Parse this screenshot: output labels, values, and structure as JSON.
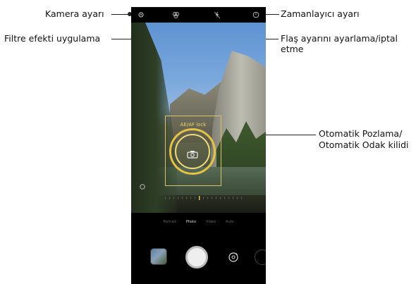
{
  "callouts": {
    "camera_settings": "Kamera ayarı",
    "filter_effect": "Filtre efekti uygulama",
    "timer_settings": "Zamanlayıcı ayarı",
    "flash_line1": "Flaş ayarını ayarlama/iptal",
    "flash_line2": "etme",
    "ae_af_line1": "Otomatik Pozlama/",
    "ae_af_line2": "Otomatik Odak kilidi"
  },
  "viewfinder": {
    "ae_af_lock_label": "AE/AF lock"
  },
  "modes": [
    "Portrait",
    "Photo",
    "Video",
    "Auto"
  ],
  "selected_mode": "Photo",
  "icons": {
    "settings": "gear-icon",
    "filter": "filter-icon",
    "flash": "flash-off-icon",
    "timer": "timer-icon",
    "shutter": "shutter-button",
    "switch_camera": "switch-camera-icon",
    "gallery": "gallery-thumbnail"
  },
  "colors": {
    "focus": "#e6c343",
    "callout_line": "#222222"
  }
}
